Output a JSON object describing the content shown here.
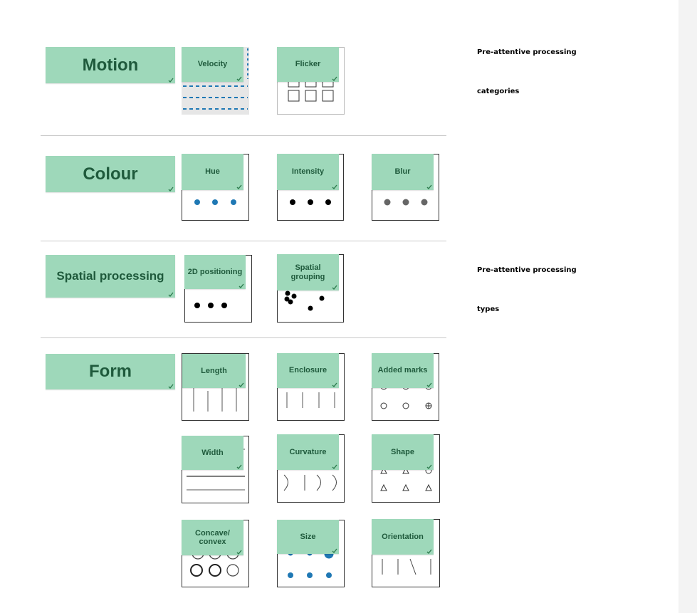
{
  "categories": {
    "motion": "Motion",
    "colour": "Colour",
    "spatial": "Spatial processing",
    "form": "Form"
  },
  "items": {
    "velocity": "Velocity",
    "flicker": "Flicker",
    "hue": "Hue",
    "intensity": "Intensity",
    "blur": "Blur",
    "positioning_2d": "2D positioning",
    "spatial_grouping": "Spatial grouping",
    "length": "Length",
    "enclosure": "Enclosure",
    "added_marks": "Added marks",
    "width": "Width",
    "curvature": "Curvature",
    "shape": "Shape",
    "concave_convex": "Concave/ convex",
    "size": "Size",
    "orientation": "Orientation"
  },
  "notes": {
    "categories_line1": "Pre-attentive processing",
    "categories_line2": "categories",
    "types_line1": "Pre-attentive processing",
    "types_line2": "types"
  },
  "colors": {
    "sticker": "#9ed8ba",
    "sticker_text": "#1f5a3c",
    "check": "#2e7d4f",
    "blue_dot": "#1f78b4",
    "velocity_dash": "#1f78b4"
  },
  "icons": {
    "sticker_check": "checkmark-icon"
  }
}
